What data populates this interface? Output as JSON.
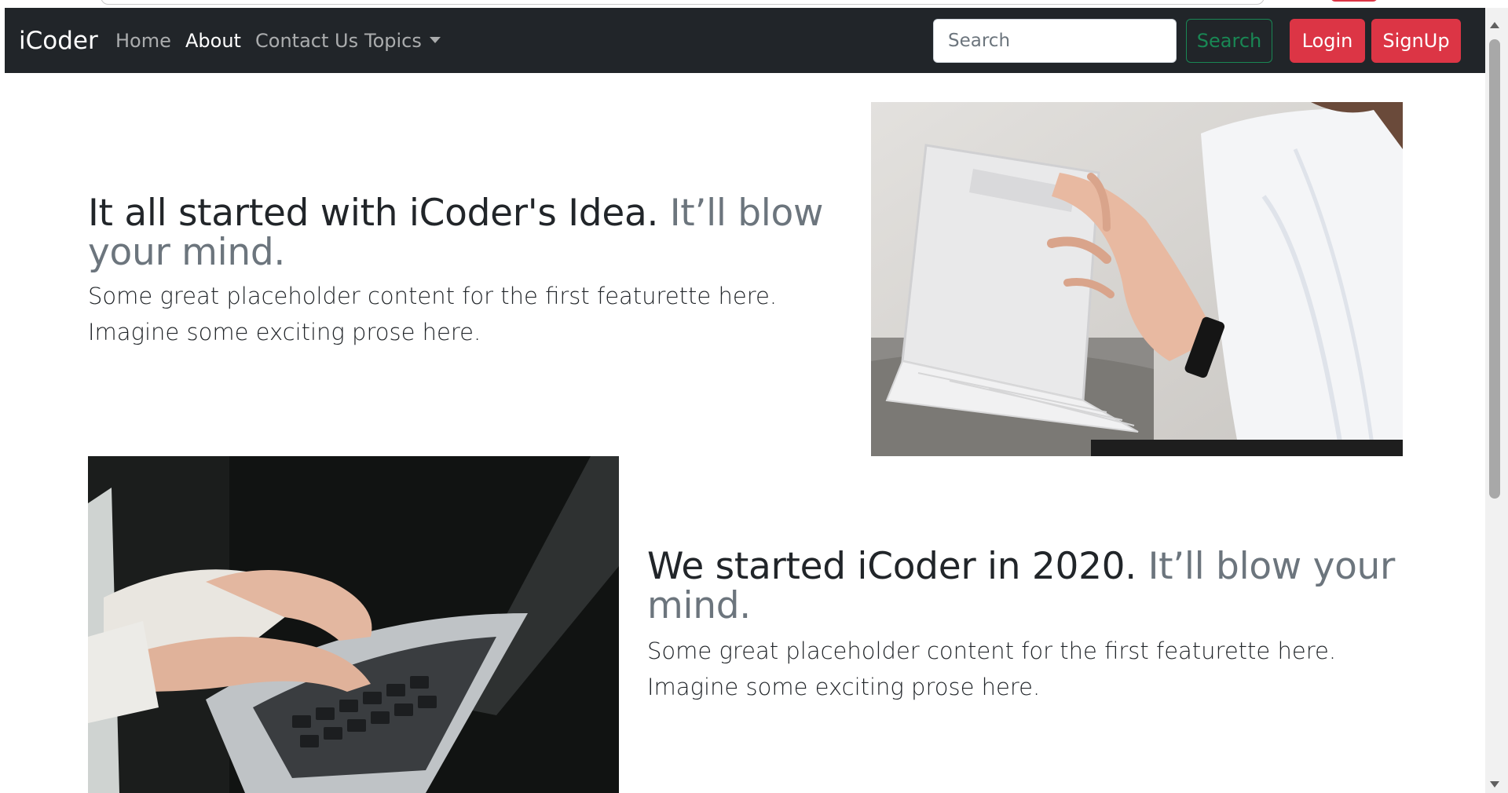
{
  "navbar": {
    "brand": "iCoder",
    "links": [
      {
        "label": "Home",
        "active": false
      },
      {
        "label": "About",
        "active": true
      },
      {
        "label": "Contact Us",
        "active": false
      },
      {
        "label": "Topics",
        "active": false
      }
    ],
    "search_placeholder": "Search",
    "search_button": "Search",
    "login_button": "Login",
    "signup_button": "SignUp"
  },
  "featurettes": [
    {
      "heading": "It all started with iCoder's Idea.",
      "heading_muted": "It’ll blow your mind.",
      "lead": "Some great placeholder content for the first featurette here. Imagine some exciting prose here.",
      "image_icon": "tablet-photo-icon"
    },
    {
      "heading": "We started iCoder in 2020.",
      "heading_muted": "It’ll blow your mind.",
      "lead": "Some great placeholder content for the first featurette here. Imagine some exciting prose here.",
      "image_icon": "laptop-photo-icon"
    }
  ],
  "colors": {
    "navbar_bg": "#212529",
    "danger": "#dc3545",
    "success": "#198754",
    "muted": "#6c757d"
  }
}
